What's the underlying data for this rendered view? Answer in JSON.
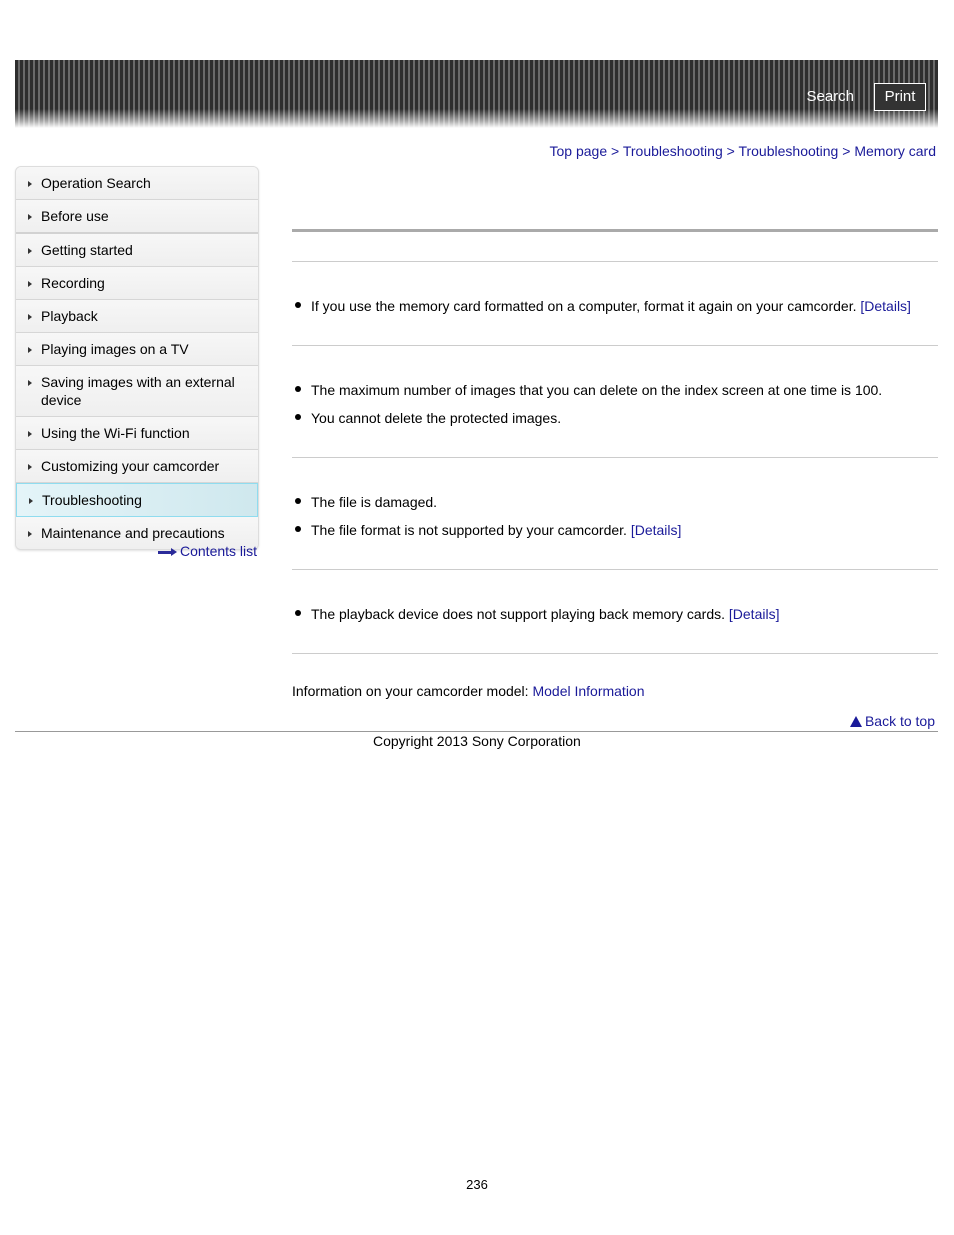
{
  "header": {
    "search_label": "Search",
    "print_label": "Print"
  },
  "breadcrumb": {
    "items": [
      "Top page",
      "Troubleshooting",
      "Troubleshooting",
      "Memory card"
    ],
    "separator": ">"
  },
  "sidebar": {
    "items": [
      {
        "label": "Operation Search"
      },
      {
        "label": "Before use"
      },
      {
        "label": "Getting started"
      },
      {
        "label": "Recording"
      },
      {
        "label": "Playback"
      },
      {
        "label": "Playing images on a TV"
      },
      {
        "label": "Saving images with an external device"
      },
      {
        "label": "Using the Wi-Fi function"
      },
      {
        "label": "Customizing your camcorder"
      },
      {
        "label": "Troubleshooting",
        "active": true
      },
      {
        "label": "Maintenance and precautions"
      }
    ],
    "contents_link": "Contents list"
  },
  "main": {
    "sections": [
      {
        "bullets": [
          {
            "text": "If you use the memory card formatted on a computer, format it again on your camcorder.",
            "link": "[Details]"
          }
        ]
      },
      {
        "bullets": [
          {
            "text": "The maximum number of images that you can delete on the index screen at one time is 100."
          },
          {
            "text": "You cannot delete the protected images."
          }
        ]
      },
      {
        "bullets": [
          {
            "text": "The file is damaged."
          },
          {
            "text": "The file format is not supported by your camcorder.",
            "link": "[Details]"
          }
        ]
      },
      {
        "bullets": [
          {
            "text": "The playback device does not support playing back memory cards.",
            "link": "[Details]"
          }
        ]
      }
    ],
    "info_label": "Information on your camcorder model:",
    "info_link": "Model Information",
    "back_to_top": "Back to top"
  },
  "footer": {
    "copyright": "Copyright 2013 Sony Corporation",
    "page_number": "236"
  },
  "colors": {
    "link": "#1a1a99",
    "active_nav_bg": "#d8eef3",
    "active_nav_border": "#8fdcef"
  }
}
